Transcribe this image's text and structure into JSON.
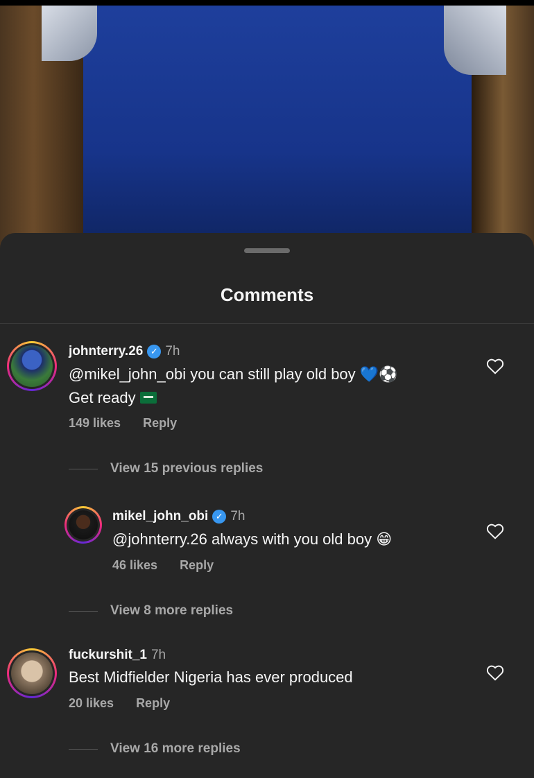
{
  "sheet": {
    "title": "Comments"
  },
  "comments": [
    {
      "username": "johnterry.26",
      "verified": true,
      "time": "7h",
      "line1_mention": "@mikel_john_obi",
      "line1_text": " you can still play old boy ",
      "line1_emoji": "💙⚽",
      "line2_text": "Get ready",
      "line2_emoji": "flag-icon",
      "likes": "149 likes",
      "reply_label": "Reply",
      "view_replies": "View 15 previous replies"
    },
    {
      "username": "mikel_john_obi",
      "verified": true,
      "time": "7h",
      "mention": "@johnterry.26",
      "text": " always with you old boy ",
      "emoji": "😁",
      "likes": "46 likes",
      "reply_label": "Reply",
      "view_replies": "View 8 more replies"
    },
    {
      "username": "fuckurshit_1",
      "verified": false,
      "time": "7h",
      "text": "Best Midfielder Nigeria has ever produced",
      "likes": "20 likes",
      "reply_label": "Reply",
      "view_replies": "View 16 more replies"
    }
  ],
  "colors": {
    "sheet_bg": "#262626",
    "secondary_text": "#a8a8a8",
    "verified_blue": "#3897f0"
  }
}
